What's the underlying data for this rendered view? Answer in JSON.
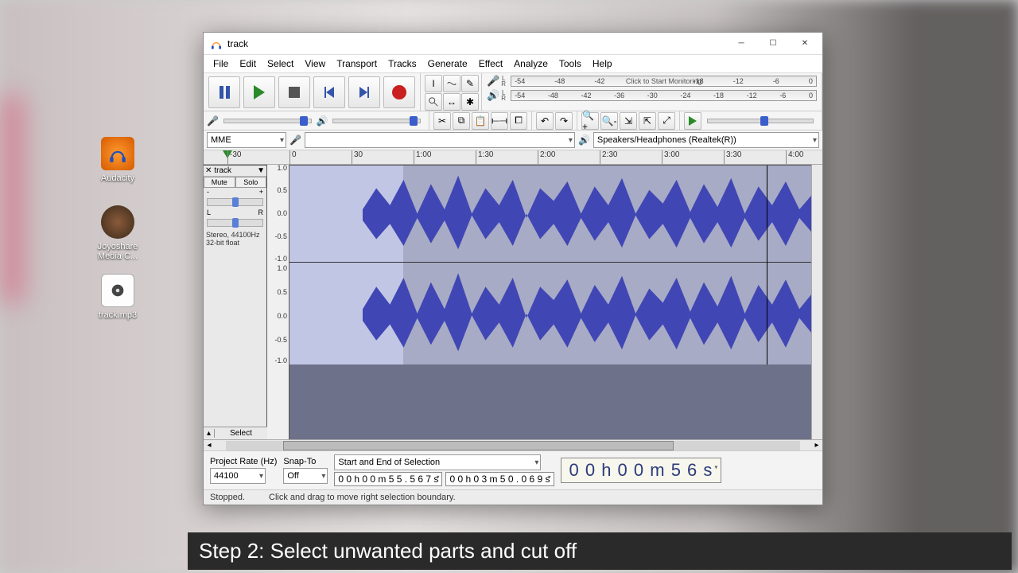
{
  "desktop": {
    "icons": [
      {
        "name": "audacity-shortcut",
        "label": "Audacity"
      },
      {
        "name": "joyoshare-shortcut",
        "label": "Joyoshare Media C..."
      },
      {
        "name": "track-file",
        "label": "track.mp3"
      }
    ]
  },
  "caption": "Step 2: Select unwanted parts and cut off",
  "window": {
    "title": "track",
    "menus": [
      "File",
      "Edit",
      "Select",
      "View",
      "Transport",
      "Tracks",
      "Generate",
      "Effect",
      "Analyze",
      "Tools",
      "Help"
    ],
    "transport": {
      "pause": "Pause",
      "play": "Play",
      "stop": "Stop",
      "skip_start": "Skip to Start",
      "skip_end": "Skip to End",
      "record": "Record"
    },
    "meter_rec": {
      "hint": "Click to Start Monitoring",
      "ticks": [
        "-54",
        "-48",
        "-42",
        "",
        "",
        "-18",
        "-12",
        "-6",
        "0"
      ]
    },
    "meter_play": {
      "ticks": [
        "-54",
        "-48",
        "-42",
        "-36",
        "-30",
        "-24",
        "-18",
        "-12",
        "-6",
        "0"
      ]
    },
    "device_bar": {
      "host": "MME",
      "output": "Speakers/Headphones (Realtek(R))"
    },
    "timeline_ticks": [
      "-30",
      "0",
      "30",
      "1:00",
      "1:30",
      "2:00",
      "2:30",
      "3:00",
      "3:30",
      "4:00"
    ],
    "track": {
      "name": "track",
      "mute": "Mute",
      "solo": "Solo",
      "gain_minus": "-",
      "gain_plus": "+",
      "pan_l": "L",
      "pan_r": "R",
      "info": "Stereo, 44100Hz 32-bit float",
      "select_btn": "Select",
      "vscale": [
        "1.0",
        "0.5",
        "0.0",
        "-0.5",
        "-1.0"
      ]
    },
    "selection": {
      "rate_label": "Project Rate (Hz)",
      "rate_value": "44100",
      "snap_label": "Snap-To",
      "snap_value": "Off",
      "range_label": "Start and End of Selection",
      "start_value": "0 0 h 0 0 m 5 5 . 5 6 7 s",
      "end_value": "0 0 h 0 3 m 5 0 . 0 6 9 s",
      "position": "0 0 h 0 0 m 5 6 s"
    },
    "status": {
      "state": "Stopped.",
      "hint": "Click and drag to move right selection boundary."
    }
  }
}
